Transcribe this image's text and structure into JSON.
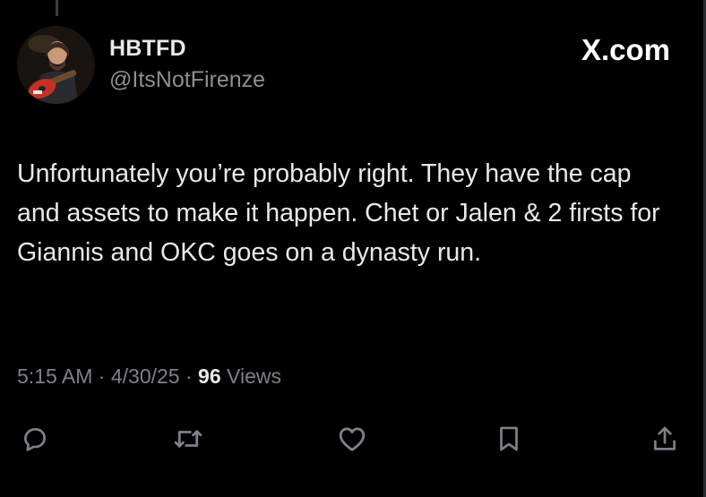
{
  "tweet": {
    "display_name": "HBTFD",
    "handle": "@ItsNotFirenze",
    "site_logo": "X.com",
    "text": "Unfortunately you’re probably right. They have the cap and assets to make it happen. Chet or Jalen & 2 firsts for Giannis and OKC goes on a dynasty run.",
    "time": "5:15 AM",
    "date": "4/30/25",
    "separator": "·",
    "views_count": "96",
    "views_label": "Views"
  },
  "actions": {
    "icons": [
      "reply-icon",
      "retweet-icon",
      "like-icon",
      "bookmark-icon",
      "share-icon"
    ]
  },
  "colors": {
    "background": "#000000",
    "text_primary": "#e7e9ea",
    "text_secondary": "#7c8288",
    "icon": "#7c8288"
  }
}
